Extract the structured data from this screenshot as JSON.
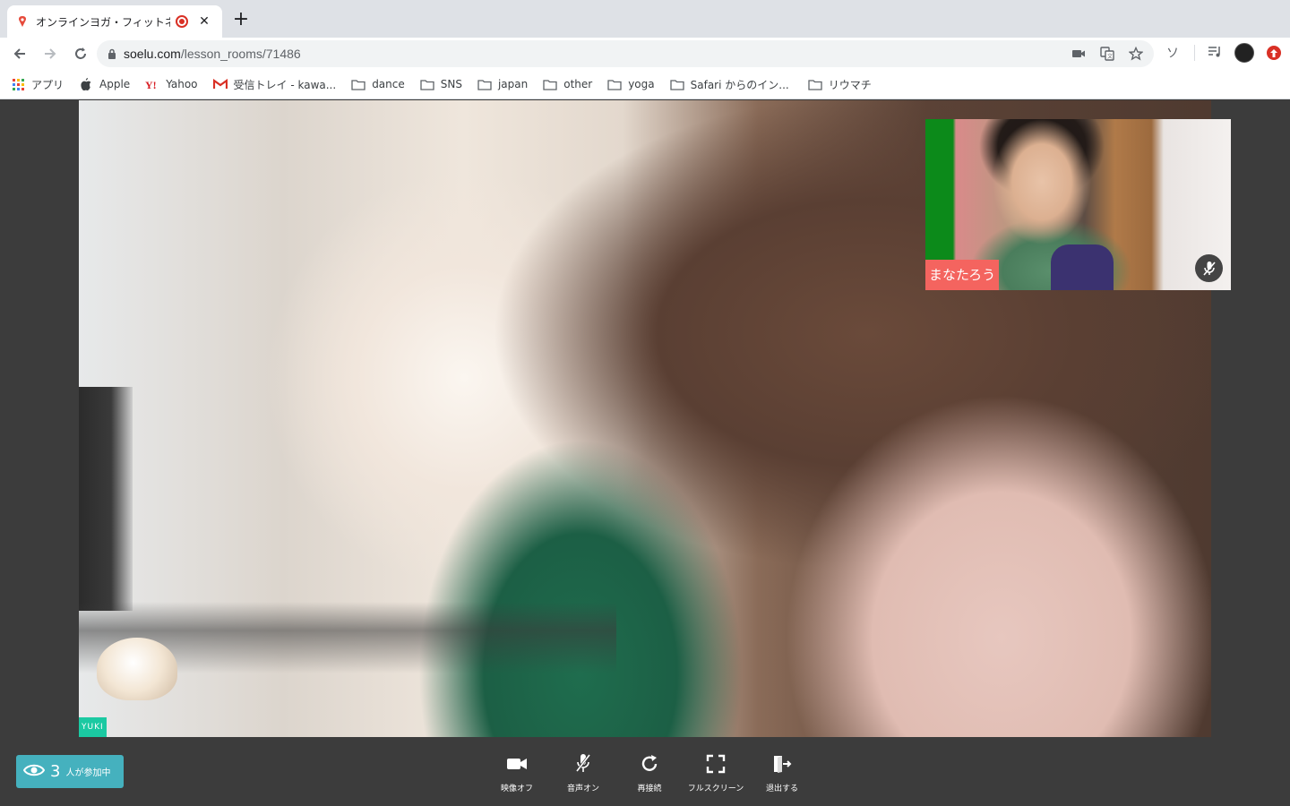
{
  "tab": {
    "title": "オンラインヨガ・フィットネ",
    "close": "✕"
  },
  "toolbar": {
    "url_host": "soelu.com",
    "url_path": "/lesson_rooms/71486",
    "ext_letter": "ソ"
  },
  "bookmarks": [
    {
      "label": "アプリ",
      "icon": "apps-grid-icon"
    },
    {
      "label": "Apple",
      "icon": "apple-icon"
    },
    {
      "label": "Yahoo",
      "icon": "yahoo-icon"
    },
    {
      "label": "受信トレイ - kawa...",
      "icon": "gmail-icon"
    },
    {
      "label": "dance",
      "icon": "folder-icon"
    },
    {
      "label": "SNS",
      "icon": "folder-icon"
    },
    {
      "label": "japan",
      "icon": "folder-icon"
    },
    {
      "label": "other",
      "icon": "folder-icon"
    },
    {
      "label": "yoga",
      "icon": "folder-icon"
    },
    {
      "label": "Safari からのイン...",
      "icon": "folder-icon"
    },
    {
      "label": "リウマチ",
      "icon": "folder-icon"
    }
  ],
  "main_video": {
    "name": "YUKI"
  },
  "pip": {
    "name": "まなたろう"
  },
  "participants": {
    "count": "3",
    "label": "人が参加中"
  },
  "controls": {
    "video_off": "映像オフ",
    "audio_on": "音声オン",
    "reconnect": "再接続",
    "fullscreen": "フルスクリーン",
    "leave": "退出する"
  }
}
